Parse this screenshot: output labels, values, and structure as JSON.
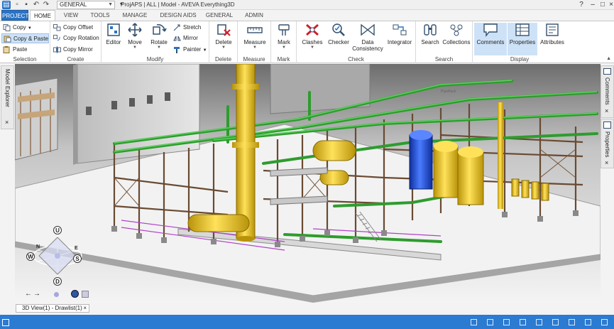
{
  "titlebar": {
    "combo_value": "GENERAL",
    "window_title": "ProjAPS | ALL | Model - AVEVA Everything3D",
    "window_buttons": [
      "?",
      "–",
      "□",
      "×"
    ]
  },
  "tabs": [
    "PROJECT",
    "HOME",
    "VIEW",
    "TOOLS",
    "MANAGE",
    "DESIGN AIDS",
    "GENERAL",
    "ADMIN"
  ],
  "ribbon": {
    "selection": {
      "label": "Selection",
      "copy": "Copy",
      "copy_paste": "Copy & Paste",
      "paste": "Paste"
    },
    "create": {
      "label": "Create",
      "copy_offset": "Copy Offset",
      "copy_rotation": "Copy Rotation",
      "copy_mirror": "Copy Mirror"
    },
    "modify": {
      "label": "Modify",
      "editor": "Editor",
      "move": "Move",
      "rotate": "Rotate",
      "stretch": "Stretch",
      "mirror": "Mirror",
      "painter": "Painter"
    },
    "delete": {
      "label": "Delete",
      "delete_btn": "Delete"
    },
    "measure": {
      "label": "Measure",
      "measure_btn": "Measure"
    },
    "mark": {
      "label": "Mark",
      "mark_btn": "Mark"
    },
    "check": {
      "label": "Check",
      "clashes": "Clashes",
      "checker": "Checker",
      "data_consistency_1": "Data",
      "data_consistency_2": "Consistency",
      "integrator": "Integrator"
    },
    "search": {
      "label": "Search",
      "search_btn": "Search",
      "collections": "Collections"
    },
    "display": {
      "label": "Display",
      "comments": "Comments",
      "properties": "Properties",
      "attributes": "Attributes"
    }
  },
  "left_panel": {
    "title": "Model Explorer"
  },
  "right_panel": {
    "comments": "Comments",
    "properties": "Properties"
  },
  "viewcube": {
    "up": "U",
    "down": "D",
    "north": "N",
    "south": "S",
    "east": "E",
    "west": "W"
  },
  "doc_tab": {
    "label": "3D View(1) - Drawlist(1)"
  }
}
